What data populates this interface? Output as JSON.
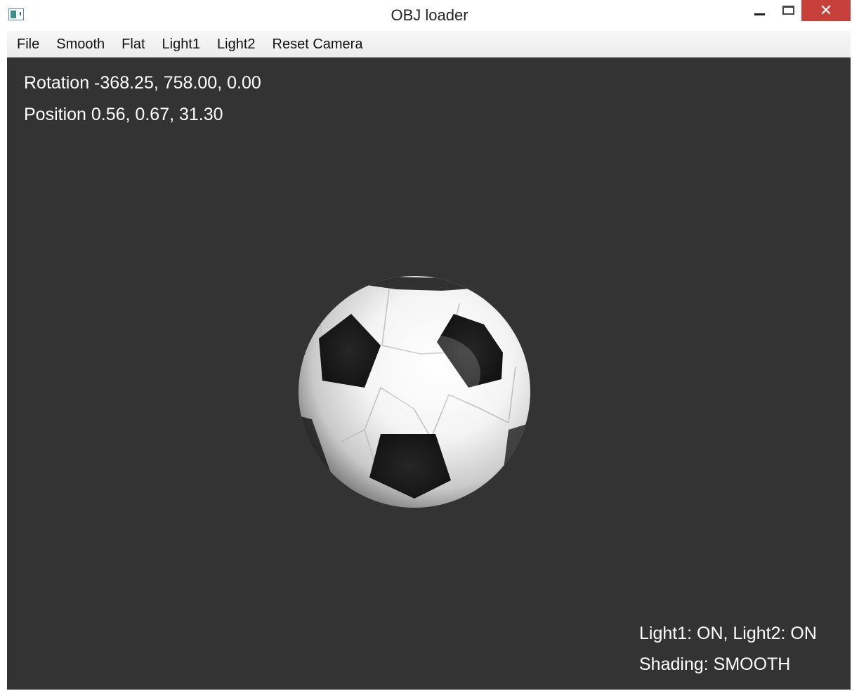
{
  "window": {
    "title": "OBJ loader",
    "close_glyph": "✕"
  },
  "menu": {
    "items": [
      {
        "label": "File"
      },
      {
        "label": "Smooth"
      },
      {
        "label": "Flat"
      },
      {
        "label": "Light1"
      },
      {
        "label": "Light2"
      },
      {
        "label": "Reset Camera"
      }
    ]
  },
  "viewport": {
    "background": "#333333",
    "rotation_text": "Rotation -368.25, 758.00, 0.00",
    "position_text": "Position 0.56, 0.67, 31.30",
    "lights_text": "Light1: ON, Light2: ON",
    "shading_text": "Shading: SMOOTH",
    "model": "soccer-ball"
  },
  "colors": {
    "close_button": "#c7403a",
    "viewport_bg": "#333333",
    "overlay_text": "#ffffff"
  }
}
